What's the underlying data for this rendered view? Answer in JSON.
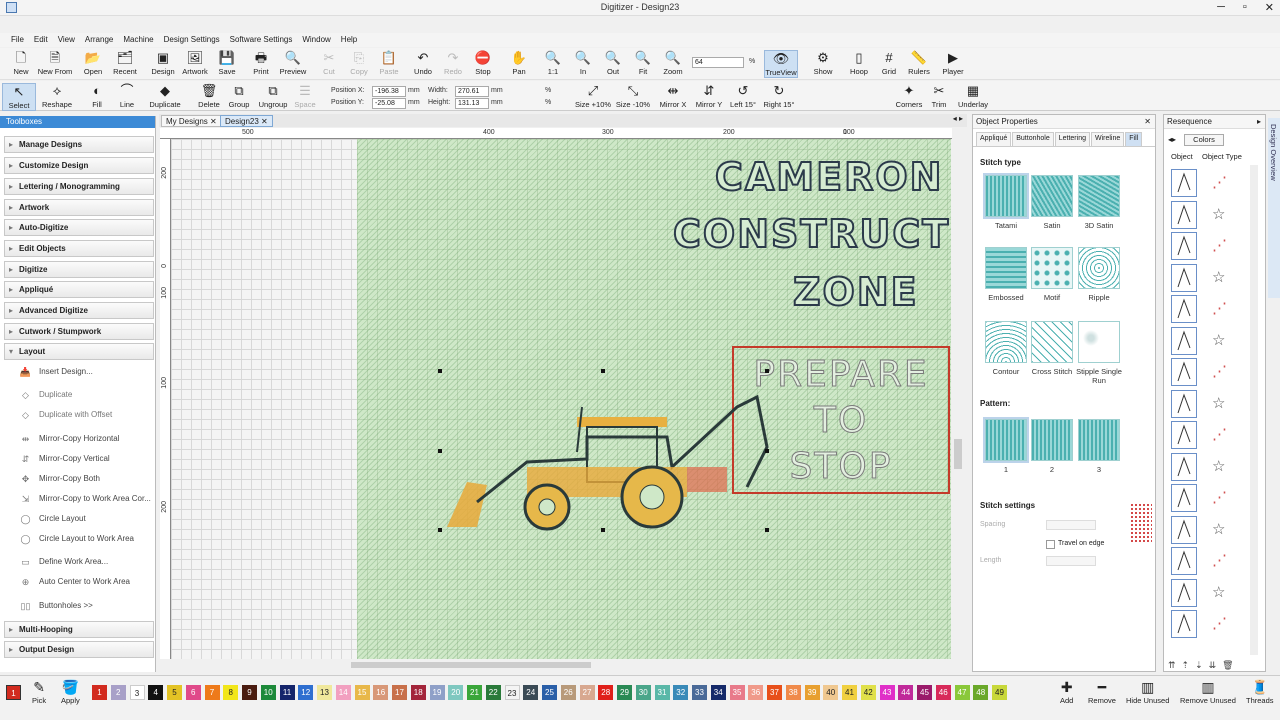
{
  "window": {
    "title": "Digitizer - Design23"
  },
  "menu": [
    "File",
    "Edit",
    "View",
    "Arrange",
    "Machine",
    "Design Settings",
    "Software Settings",
    "Window",
    "Help"
  ],
  "toolbar1": [
    {
      "label": "New",
      "icon": "new-file-icon",
      "glyph": "🗋",
      "dis": false
    },
    {
      "label": "New From",
      "icon": "new-from-icon",
      "glyph": "🗎",
      "dis": false
    },
    {
      "label": "Open",
      "icon": "open-folder-icon",
      "glyph": "📂",
      "dis": false
    },
    {
      "label": "Recent",
      "icon": "recent-icon",
      "glyph": "🗂",
      "dis": false
    },
    {
      "label": "Design",
      "icon": "design-icon",
      "glyph": "▣",
      "dis": false
    },
    {
      "label": "Artwork",
      "icon": "artwork-icon",
      "glyph": "🖼",
      "dis": false
    },
    {
      "label": "Save",
      "icon": "save-icon",
      "glyph": "💾",
      "dis": false
    },
    {
      "label": "Print",
      "icon": "print-icon",
      "glyph": "🖶",
      "dis": false
    },
    {
      "label": "Preview",
      "icon": "preview-icon",
      "glyph": "🔍",
      "dis": false
    },
    {
      "label": "Cut",
      "icon": "cut-icon",
      "glyph": "✂",
      "dis": true
    },
    {
      "label": "Copy",
      "icon": "copy-icon",
      "glyph": "⎘",
      "dis": true
    },
    {
      "label": "Paste",
      "icon": "paste-icon",
      "glyph": "📋",
      "dis": true
    },
    {
      "label": "Undo",
      "icon": "undo-icon",
      "glyph": "↶",
      "dis": false
    },
    {
      "label": "Redo",
      "icon": "redo-icon",
      "glyph": "↷",
      "dis": true
    },
    {
      "label": "Stop",
      "icon": "stop-icon",
      "glyph": "⛔",
      "dis": false
    },
    {
      "label": "Pan",
      "icon": "pan-hand-icon",
      "glyph": "✋",
      "dis": false
    },
    {
      "label": "1:1",
      "icon": "zoom-1to1-icon",
      "glyph": "🔍",
      "dis": false
    },
    {
      "label": "In",
      "icon": "zoom-in-icon",
      "glyph": "🔍",
      "dis": false
    },
    {
      "label": "Out",
      "icon": "zoom-out-icon",
      "glyph": "🔍",
      "dis": false
    },
    {
      "label": "Fit",
      "icon": "zoom-fit-icon",
      "glyph": "🔍",
      "dis": false
    },
    {
      "label": "Zoom",
      "icon": "zoom-icon",
      "glyph": "🔍",
      "dis": false
    },
    {
      "label": "TrueView",
      "icon": "trueview-eye-icon",
      "glyph": "👁",
      "dis": false
    },
    {
      "label": "Show",
      "icon": "show-icon",
      "glyph": "⚙",
      "dis": false
    },
    {
      "label": "Hoop",
      "icon": "hoop-icon",
      "glyph": "▯",
      "dis": false
    },
    {
      "label": "Grid",
      "icon": "grid-icon",
      "glyph": "#",
      "dis": false
    },
    {
      "label": "Rulers",
      "icon": "rulers-icon",
      "glyph": "📏",
      "dis": false
    },
    {
      "label": "Player",
      "icon": "player-icon",
      "glyph": "▶",
      "dis": false
    }
  ],
  "zoom_value": "64",
  "zoom_unit": "%",
  "toolbar2": [
    {
      "label": "Select",
      "icon": "select-arrow-icon",
      "glyph": "↖",
      "dis": false
    },
    {
      "label": "Reshape",
      "icon": "reshape-icon",
      "glyph": "⟡",
      "dis": false
    },
    {
      "label": "Fill",
      "icon": "fill-icon",
      "glyph": "◐",
      "dis": false
    },
    {
      "label": "Line",
      "icon": "line-icon",
      "glyph": "⌒",
      "dis": false
    },
    {
      "label": "Duplicate",
      "icon": "duplicate-icon",
      "glyph": "◆",
      "dis": false
    },
    {
      "label": "Delete",
      "icon": "delete-icon",
      "glyph": "🗑",
      "dis": false
    },
    {
      "label": "Group",
      "icon": "group-icon",
      "glyph": "⧉",
      "dis": false
    },
    {
      "label": "Ungroup",
      "icon": "ungroup-icon",
      "glyph": "⧉",
      "dis": false
    },
    {
      "label": "Space",
      "icon": "space-icon",
      "glyph": "☰",
      "dis": true
    }
  ],
  "position": {
    "x_label": "Position X:",
    "x": "-196.38",
    "y_label": "Position Y:",
    "y": "-25.08",
    "unit": "mm",
    "w_label": "Width:",
    "w": "270.61",
    "h_label": "Height:",
    "h": "131.13",
    "pct": "%"
  },
  "toolbar2b": [
    {
      "label": "Size +10%",
      "icon": "size-plus-icon",
      "glyph": "⤢"
    },
    {
      "label": "Size -10%",
      "icon": "size-minus-icon",
      "glyph": "⤡"
    },
    {
      "label": "Mirror X",
      "icon": "mirror-x-icon",
      "glyph": "⇹"
    },
    {
      "label": "Mirror Y",
      "icon": "mirror-y-icon",
      "glyph": "⇵"
    },
    {
      "label": "Left 15°",
      "icon": "rotate-left-icon",
      "glyph": "↺"
    },
    {
      "label": "Right 15°",
      "icon": "rotate-right-icon",
      "glyph": "↻"
    }
  ],
  "toolbar2c": [
    {
      "label": "Corners",
      "icon": "corners-icon",
      "glyph": "✦"
    },
    {
      "label": "Trim",
      "icon": "trim-icon",
      "glyph": "✂"
    },
    {
      "label": "Underlay",
      "icon": "underlay-icon",
      "glyph": "▦"
    }
  ],
  "toolboxes": {
    "title": "Toolboxes",
    "categories": [
      "Manage Designs",
      "Customize Design",
      "Lettering / Monogramming",
      "Artwork",
      "Auto-Digitize",
      "Edit Objects",
      "Digitize",
      "Appliqué",
      "Advanced Digitize",
      "Cutwork / Stumpwork",
      "Layout"
    ],
    "layout_items": [
      "Insert Design...",
      "Duplicate",
      "Duplicate with Offset",
      "Mirror-Copy Horizontal",
      "Mirror-Copy Vertical",
      "Mirror-Copy Both",
      "Mirror-Copy to Work Area Cor...",
      "Circle Layout",
      "Circle Layout to Work Area",
      "Define Work Area...",
      "Auto Center to Work Area",
      "Buttonholes >>"
    ],
    "bottom": [
      "Multi-Hooping",
      "Output Design"
    ]
  },
  "doc_tabs": [
    "My Designs",
    "Design23"
  ],
  "ruler_top": [
    "500",
    "400",
    "300",
    "200",
    "100",
    "0"
  ],
  "ruler_left": [
    "200",
    "100",
    "0",
    "100",
    "200"
  ],
  "design_text": {
    "line1": "CAMERON",
    "line2": "CONSTRUCT",
    "line3": "ZONE",
    "sign1": "PREPARE",
    "sign2": "TO",
    "sign3": "STOP"
  },
  "obj_props": {
    "title": "Object Properties",
    "tabs": [
      "Appliqué",
      "Buttonhole",
      "Lettering",
      "Wireline",
      "Fill"
    ],
    "stitch_type": "Stitch type",
    "stitches": [
      "Tatami",
      "Satin",
      "3D Satin",
      "Embossed",
      "Motif",
      "Ripple",
      "Contour",
      "Cross Stitch",
      "Stipple Single Run"
    ],
    "pattern": "Pattern:",
    "patterns": [
      "1",
      "2",
      "3"
    ],
    "stitch_settings": "Stitch settings",
    "spacing": "Spacing",
    "travel": "Travel on edge",
    "length": "Length"
  },
  "resequence": {
    "title": "Resequence",
    "colors": "Colors",
    "col1": "Object",
    "col2": "Object Type"
  },
  "side_tab": "Design Overview",
  "palette": {
    "pick": "Pick",
    "apply": "Apply",
    "colors": [
      [
        "1",
        "#d22b1f"
      ],
      [
        "2",
        "#a8a0c8"
      ],
      [
        "3",
        "#ffffff"
      ],
      [
        "4",
        "#111111"
      ],
      [
        "5",
        "#e3c325"
      ],
      [
        "6",
        "#e04a8a"
      ],
      [
        "7",
        "#ee7a1a"
      ],
      [
        "8",
        "#f2e61a"
      ],
      [
        "9",
        "#4a1c10"
      ],
      [
        "10",
        "#1d8a3a"
      ],
      [
        "11",
        "#15256b"
      ],
      [
        "12",
        "#2f6fd0"
      ],
      [
        "13",
        "#f0e89c"
      ],
      [
        "14",
        "#f2a0c0"
      ],
      [
        "15",
        "#e8b84a"
      ],
      [
        "16",
        "#d89878"
      ],
      [
        "17",
        "#c8704a"
      ],
      [
        "18",
        "#a3253a"
      ],
      [
        "19",
        "#8fa0c8"
      ],
      [
        "20",
        "#7fc8c0"
      ],
      [
        "21",
        "#3aa63a"
      ],
      [
        "22",
        "#2a7a3a"
      ],
      [
        "23",
        "#f4f4f4"
      ],
      [
        "24",
        "#3a4a55"
      ],
      [
        "25",
        "#2a5fa8"
      ],
      [
        "26",
        "#b89a7a"
      ],
      [
        "27",
        "#d8a890"
      ],
      [
        "28",
        "#e0201a"
      ],
      [
        "29",
        "#2a8a55"
      ],
      [
        "30",
        "#4aa68a"
      ],
      [
        "31",
        "#5ab8a8"
      ],
      [
        "32",
        "#3a8ab8"
      ],
      [
        "33",
        "#4a6a98"
      ],
      [
        "34",
        "#152a6a"
      ],
      [
        "35",
        "#e87a8a"
      ],
      [
        "36",
        "#f09a8a"
      ],
      [
        "37",
        "#e8501a"
      ],
      [
        "38",
        "#f08a4a"
      ],
      [
        "39",
        "#e8a030"
      ],
      [
        "40",
        "#f0c890"
      ],
      [
        "41",
        "#f0d040"
      ],
      [
        "42",
        "#e0e04a"
      ],
      [
        "43",
        "#e030c8"
      ],
      [
        "44",
        "#c02a9a"
      ],
      [
        "45",
        "#9a1a6a"
      ],
      [
        "46",
        "#d82a5a"
      ],
      [
        "47",
        "#8ac83a"
      ],
      [
        "48",
        "#6aa82a"
      ],
      [
        "49",
        "#c8d83a"
      ]
    ],
    "right_buttons": [
      {
        "label": "Add",
        "icon": "add-plus-icon",
        "glyph": "✚"
      },
      {
        "label": "Remove",
        "icon": "remove-minus-icon",
        "glyph": "━"
      },
      {
        "label": "Hide Unused",
        "icon": "hide-unused-icon",
        "glyph": "▥"
      },
      {
        "label": "Remove Unused",
        "icon": "remove-unused-icon",
        "glyph": "▥"
      },
      {
        "label": "Threads",
        "icon": "threads-icon",
        "glyph": "🧵"
      }
    ]
  }
}
